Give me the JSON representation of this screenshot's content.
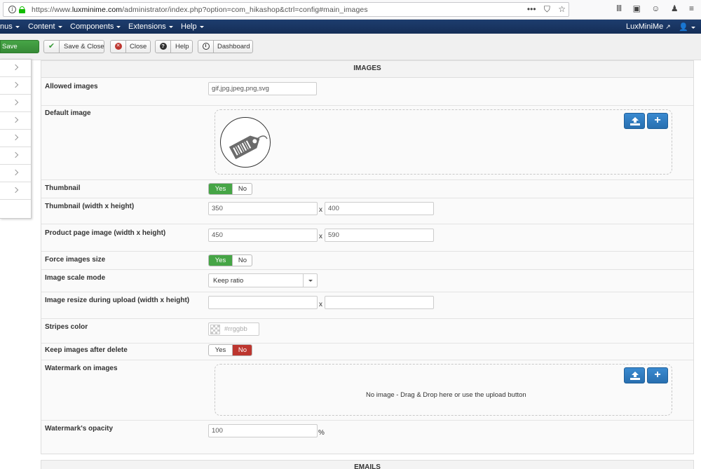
{
  "browser": {
    "url_prefix": "https://www.",
    "url_domain": "luxminime.com",
    "url_rest": "/administrator/index.php?option=com_hikashop&ctrl=config#main_images",
    "icons": [
      "info-icon",
      "lock-icon",
      "more-icon",
      "pocket-icon",
      "bookmark-star-icon",
      "library-icon",
      "sidebar-icon",
      "account-icon",
      "extension-icon",
      "menu-icon"
    ]
  },
  "nav": {
    "items": [
      {
        "label": "nus"
      },
      {
        "label": "Content"
      },
      {
        "label": "Components"
      },
      {
        "label": "Extensions"
      },
      {
        "label": "Help"
      }
    ],
    "site_link": "LuxMiniMe"
  },
  "toolbar": {
    "save_label": "Save",
    "save_close_label": "Save & Close",
    "close_label": "Close",
    "help_label": "Help",
    "dashboard_label": "Dashboard"
  },
  "sidemenu": {
    "item_count": 8
  },
  "panel": {
    "title": "IMAGES",
    "rows": {
      "allowed_images": {
        "label": "Allowed images",
        "value": "gif,jpg,jpeg,png,svg"
      },
      "default_image": {
        "label": "Default image"
      },
      "thumbnail": {
        "label": "Thumbnail",
        "yes": "Yes",
        "no": "No",
        "selected": "Yes"
      },
      "thumbnail_size": {
        "label": "Thumbnail (width x height)",
        "width": "350",
        "sep": "x",
        "height": "400"
      },
      "product_page_size": {
        "label": "Product page image (width x height)",
        "width": "450",
        "sep": "x",
        "height": "590"
      },
      "force_size": {
        "label": "Force images size",
        "yes": "Yes",
        "no": "No",
        "selected": "Yes"
      },
      "scale_mode": {
        "label": "Image scale mode",
        "value": "Keep ratio"
      },
      "resize_upload": {
        "label": "Image resize during upload (width x height)",
        "width": "",
        "sep": "x",
        "height": ""
      },
      "stripes_color": {
        "label": "Stripes color",
        "placeholder": "#rrggbb"
      },
      "keep_after_delete": {
        "label": "Keep images after delete",
        "yes": "Yes",
        "no": "No",
        "selected": "No"
      },
      "watermark": {
        "label": "Watermark on images",
        "drop_message": "No image - Drag & Drop here or use the upload button",
        "add_symbol": "+"
      },
      "watermark_opacity": {
        "label": "Watermark's opacity",
        "value": "100",
        "unit": "%"
      }
    }
  },
  "bottom_panel": {
    "title": "EMAILS"
  },
  "colors": {
    "nav_bg": "#1a3867",
    "save_green": "#46a546",
    "no_red": "#bd362f",
    "upload_blue": "#2f7dbf"
  }
}
